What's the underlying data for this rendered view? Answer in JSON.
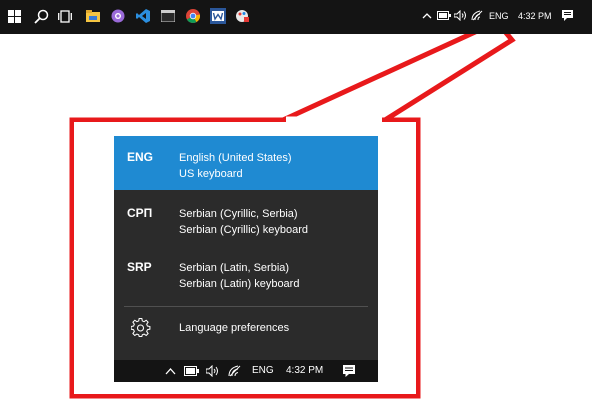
{
  "taskbar": {
    "tray": {
      "language": "ENG",
      "time": "4:32 PM"
    },
    "icons": [
      "windows-start-icon",
      "search-icon",
      "task-view-icon",
      "file-explorer-icon",
      "app-purple-icon",
      "vscode-icon",
      "terminal-icon",
      "chrome-icon",
      "word-icon",
      "paint-icon"
    ],
    "tray_icons": [
      "chevron-up-icon",
      "battery-icon",
      "volume-icon",
      "wifi-icon",
      "action-center-icon"
    ]
  },
  "language_flyout": {
    "languages": [
      {
        "code": "ENG",
        "name": "English (United States)",
        "keyboard": "US keyboard",
        "selected": true
      },
      {
        "code": "СРП",
        "name": "Serbian (Cyrillic, Serbia)",
        "keyboard": "Serbian (Cyrillic) keyboard",
        "selected": false
      },
      {
        "code": "SRP",
        "name": "Serbian (Latin, Serbia)",
        "keyboard": "Serbian (Latin) keyboard",
        "selected": false
      }
    ],
    "preferences_label": "Language preferences"
  },
  "mini_taskbar": {
    "language": "ENG",
    "time": "4:32 PM"
  },
  "colors": {
    "taskbar_bg": "#141414",
    "flyout_bg": "#2b2b2b",
    "selected_bg": "#1f8ad2",
    "callout": "#e8191b"
  }
}
